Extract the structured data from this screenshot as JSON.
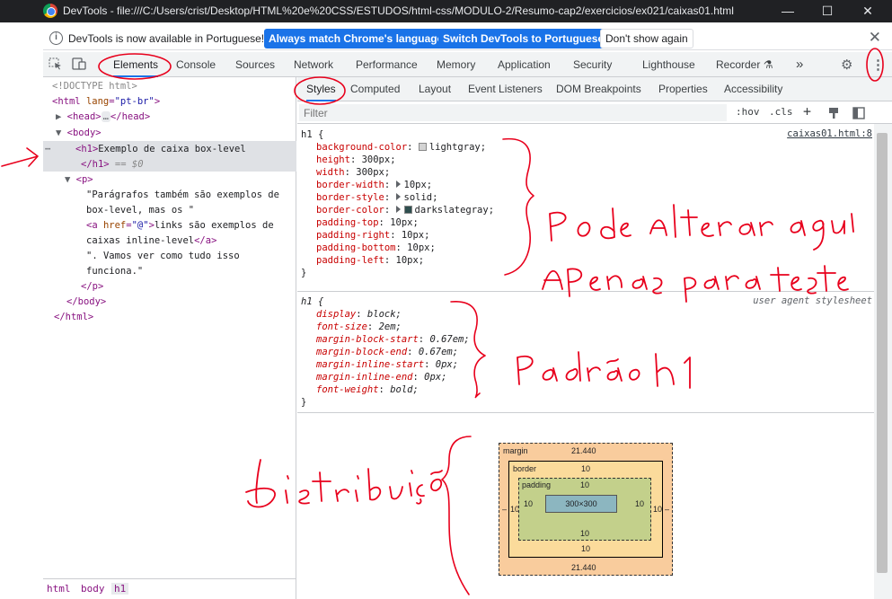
{
  "window": {
    "title": "DevTools - file:///C:/Users/crist/Desktop/HTML%20e%20CSS/ESTUDOS/html-css/MODULO-2/Resumo-cap2/exercicios/ex021/caixas01.html"
  },
  "infobar": {
    "message": "DevTools is now available in Portuguese!",
    "primary_button": "Always match Chrome's language",
    "secondary_button": "Switch DevTools to Portuguese",
    "dismiss_button": "Don't show again"
  },
  "tabs": [
    "Elements",
    "Console",
    "Sources",
    "Network",
    "Performance",
    "Memory",
    "Application",
    "Security",
    "Lighthouse",
    "Recorder"
  ],
  "more_tabs": "»",
  "dom": {
    "doctype": "<!DOCTYPE html>",
    "html_open_tag": "<html ",
    "html_lang_attr": "lang",
    "html_lang_val": "\"pt-br\"",
    "html_close": ">",
    "head_open": "<head>",
    "head_ellipsis": "…",
    "head_close": "</head>",
    "body_open": "<body>",
    "h1_open": "<h1>",
    "h1_text": "Exemplo de caixa box-level",
    "h1_close": "</h1>",
    "h1_dollar": " == $0",
    "p_open": "<p>",
    "p_text_1": "\"Parágrafos também são exemplos de",
    "p_text_2": "box-level, mas os \"",
    "a_open_tag": "<a ",
    "a_href_attr": "href",
    "a_href_val": "\"@\"",
    "a_gt": ">",
    "a_text": "links são exemplos de",
    "a_text_2": "caixas inline-level",
    "a_close": "</a>",
    "p_text_3": "\". Vamos ver como tudo isso",
    "p_text_4": "funciona.\"",
    "p_close": "</p>",
    "body_close": "</body>",
    "html_close_tag": "</html>"
  },
  "breadcrumbs": [
    "html",
    "body",
    "h1"
  ],
  "subtabs": [
    "Styles",
    "Computed",
    "Layout",
    "Event Listeners",
    "DOM Breakpoints",
    "Properties",
    "Accessibility"
  ],
  "filter": {
    "placeholder": "Filter",
    "hov": ":hov",
    "cls": ".cls",
    "plus": "+"
  },
  "rules": {
    "h1_author": {
      "selector": "h1 {",
      "source": "caixas01.html:8",
      "declarations": [
        {
          "prop": "background-color",
          "value": "lightgray;",
          "swatch": "#d3d3d3"
        },
        {
          "prop": "height",
          "value": "300px;"
        },
        {
          "prop": "width",
          "value": "300px;"
        },
        {
          "prop": "border-width",
          "value": "10px;"
        },
        {
          "prop": "border-style",
          "value": "solid;"
        },
        {
          "prop": "border-color",
          "value": "darkslategray;",
          "swatch": "#2f4f4f"
        },
        {
          "prop": "padding-top",
          "value": "10px;"
        },
        {
          "prop": "padding-right",
          "value": "10px;"
        },
        {
          "prop": "padding-bottom",
          "value": "10px;"
        },
        {
          "prop": "padding-left",
          "value": "10px;"
        }
      ],
      "close": "}"
    },
    "h1_ua": {
      "selector": "h1 {",
      "source": "user agent stylesheet",
      "declarations": [
        {
          "prop": "display",
          "value": "block;"
        },
        {
          "prop": "font-size",
          "value": "2em;"
        },
        {
          "prop": "margin-block-start",
          "value": "0.67em;"
        },
        {
          "prop": "margin-block-end",
          "value": "0.67em;"
        },
        {
          "prop": "margin-inline-start",
          "value": "0px;"
        },
        {
          "prop": "margin-inline-end",
          "value": "0px;"
        },
        {
          "prop": "font-weight",
          "value": "bold;"
        }
      ],
      "close": "}"
    }
  },
  "box_model": {
    "margin_label": "margin",
    "margin_top": "21.440",
    "margin_bottom": "21.440",
    "margin_left": "–",
    "margin_right": "–",
    "border_label": "border",
    "border_top": "10",
    "border_bottom": "10",
    "border_left": "10",
    "border_right": "10",
    "padding_label": "padding",
    "padding_top": "10",
    "padding_bottom": "10",
    "padding_left": "10",
    "padding_right": "10",
    "content": "300×300"
  },
  "colors": {
    "accent": "#1a73e8",
    "annotation_red": "#e8001c",
    "margin": "#f9cc9d",
    "border": "#fbdb9b",
    "padding": "#c3d08b",
    "content": "#8cb6c0"
  }
}
